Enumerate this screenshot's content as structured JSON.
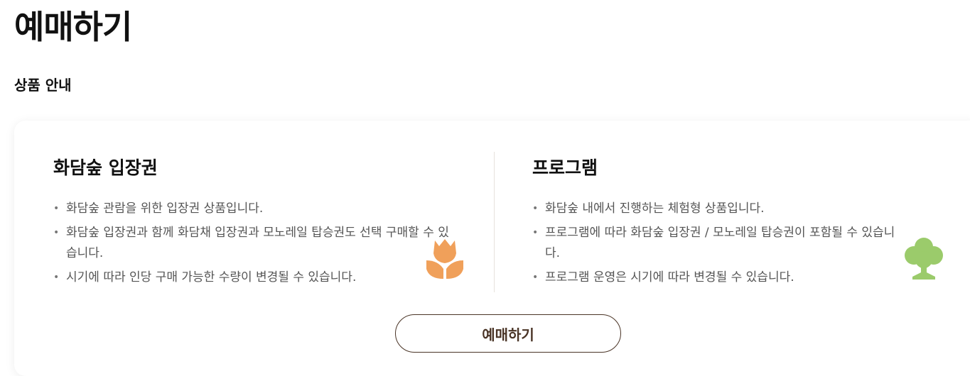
{
  "page": {
    "title": "예매하기",
    "section_title": "상품 안내"
  },
  "products": [
    {
      "title": "화담숲 입장권",
      "icon": "tulip-icon",
      "icon_color": "#F0A05A",
      "items": [
        "화담숲 관람을 위한 입장권 상품입니다.",
        "화담숲 입장권과 함께 화담채 입장권과 모노레일 탑승권도 선택 구매할 수 있습니다.",
        "시기에 따라 인당 구매 가능한 수량이 변경될 수 있습니다."
      ]
    },
    {
      "title": "프로그램",
      "icon": "tree-icon",
      "icon_color": "#9BCB6B",
      "items": [
        "화담숲 내에서 진행하는 체험형 상품입니다.",
        "프로그램에 따라 화담숲 입장권 / 모노레일 탑승권이 포함될 수 있습니다.",
        "프로그램 운영은 시기에 따라 변경될 수 있습니다."
      ]
    }
  ],
  "button": {
    "label": "예매하기"
  },
  "colors": {
    "button_border": "#4A3426",
    "text_muted": "#555555"
  }
}
